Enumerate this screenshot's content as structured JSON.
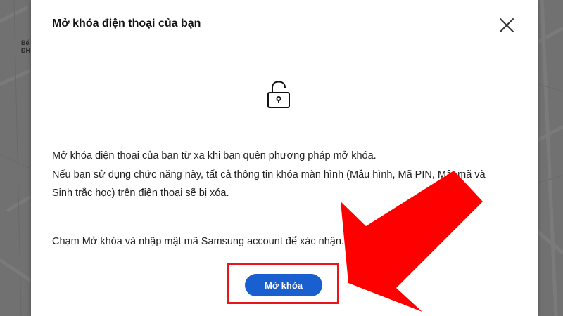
{
  "map": {
    "label_line1": "Bế",
    "label_line2": "ĐH"
  },
  "dialog": {
    "title": "Mở khóa điện thoại của bạn",
    "description_lines": [
      "Mở khóa điện thoại của bạn từ xa khi bạn quên phương pháp mở khóa.",
      "Nếu bạn sử dụng chức năng này, tất cả thông tin khóa màn hình (Mẫu hình, Mã PIN, Mật mã và",
      "Sinh trắc học) trên điện thoại sẽ bị xóa."
    ],
    "instruction": "Chạm Mở khóa và nhập mật mã Samsung account để xác nhận.",
    "unlock_button_label": "Mở khóa"
  },
  "icons": {
    "close": "close-icon",
    "lock": "unlocked-padlock-icon",
    "arrow": "red-arrow-annotation"
  },
  "colors": {
    "button_bg": "#1a5fd0",
    "highlight": "#e8161b",
    "arrow": "#ff0000",
    "backdrop": "#3a3a3a"
  }
}
